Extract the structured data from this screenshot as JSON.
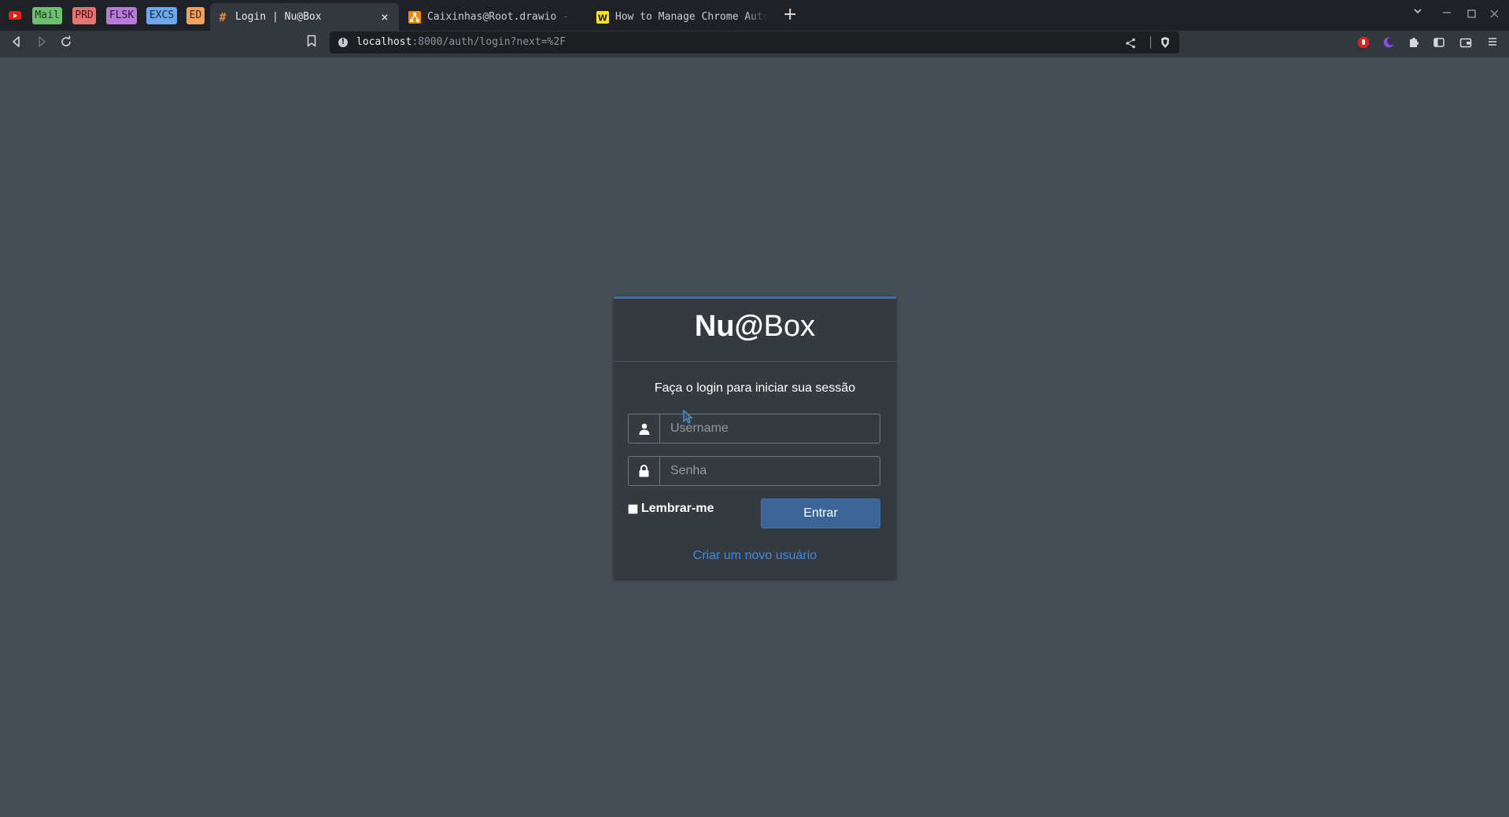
{
  "browser": {
    "pinned_tabs": [
      {
        "label": "Mail",
        "bg": "#6fbf73",
        "fg": "#1b3b1d"
      },
      {
        "label": "PRD",
        "bg": "#e57373",
        "fg": "#4a1515"
      },
      {
        "label": "FLSK",
        "bg": "#b57bd6",
        "fg": "#2e1440"
      },
      {
        "label": "EXCS",
        "bg": "#6ea8e8",
        "fg": "#102a48"
      },
      {
        "label": "ED",
        "bg": "#f0a060",
        "fg": "#4a2508"
      }
    ],
    "tabs": [
      {
        "title": "Login | Nu@Box",
        "active": true,
        "favicon": "hash-icon"
      },
      {
        "title": "Caixinhas@Root.drawio - d",
        "active": false,
        "favicon": "drawio-icon"
      },
      {
        "title": "How to Manage Chrome Auto",
        "active": false,
        "favicon": "w-icon"
      }
    ],
    "new_tab_label": "+",
    "url": {
      "host": "localhost",
      "rest": ":8000/auth/login?next=%2F"
    }
  },
  "login": {
    "logo_bold": "Nu@",
    "logo_regular": "Box",
    "message": "Faça o login para iniciar sua sessão",
    "username_placeholder": "Username",
    "password_placeholder": "Senha",
    "remember_label": "Lembrar-me",
    "remember_checked": false,
    "submit_label": "Entrar",
    "register_link": "Criar um novo usuário"
  },
  "colors": {
    "page_bg": "#454d55",
    "card_bg": "#343a40",
    "accent": "#3f6fa7",
    "button": "#3c6597",
    "link": "#3f8ce0"
  }
}
